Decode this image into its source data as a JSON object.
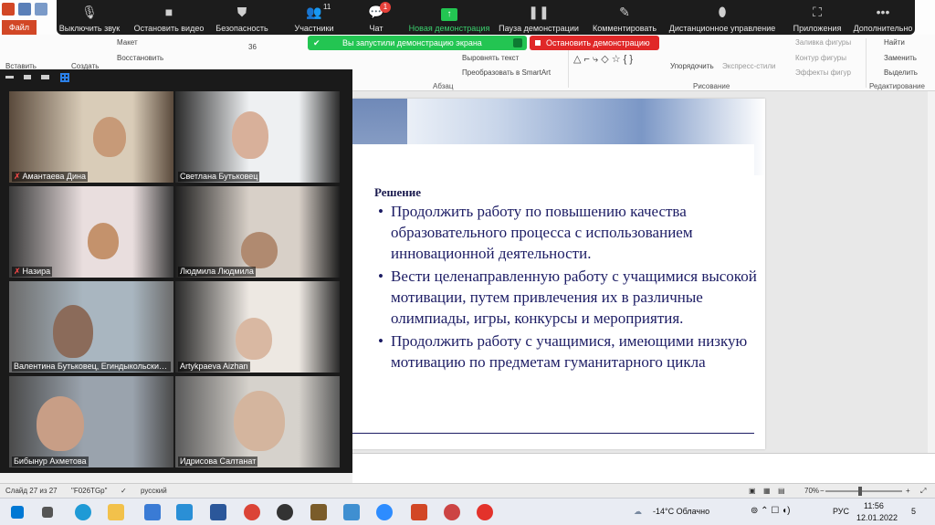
{
  "powerpoint": {
    "file_tab": "Файл",
    "ribbon": {
      "insert_label": "Вставить",
      "create_label": "Создать",
      "layout_label": "Макет",
      "restore_label": "Восстановить",
      "font_size": "36",
      "align_text": "Выровнять текст",
      "smartart": "Преобразовать в SmartArt",
      "paragraph_group": "Абзац",
      "arrange_label": "Упорядочить",
      "quick_styles": "Экспресс-стили",
      "drawing_group": "Рисование",
      "shape_fill": "Заливка фигуры",
      "shape_outline": "Контур фигуры",
      "shape_effects": "Эффекты фигур",
      "find": "Найти",
      "replace": "Заменить",
      "select": "Выделить",
      "editing_group": "Редактирование"
    },
    "statusbar": {
      "slide_counter": "Слайд 27 из 27",
      "theme": "\"F026TGp\"",
      "language": "русский",
      "zoom": "70%"
    }
  },
  "zoom": {
    "toolbar": [
      {
        "key": "mute",
        "label": "Выключить звук",
        "icon": "microphone-icon",
        "glyph": "🎙"
      },
      {
        "key": "video",
        "label": "Остановить видео",
        "icon": "camera-icon",
        "glyph": "■"
      },
      {
        "key": "security",
        "label": "Безопасность",
        "icon": "shield-icon",
        "glyph": "⛊"
      },
      {
        "key": "participants",
        "label": "Участники",
        "icon": "people-icon",
        "glyph": "👥"
      },
      {
        "key": "chat",
        "label": "Чат",
        "icon": "chat-bubble-icon",
        "glyph": "💬"
      },
      {
        "key": "new-share",
        "label": "Новая демонстрация",
        "icon": "share-arrow-icon",
        "glyph": "↑"
      },
      {
        "key": "pause-share",
        "label": "Пауза демонстрации",
        "icon": "pause-icon",
        "glyph": "❚❚"
      },
      {
        "key": "annotate",
        "label": "Комментировать",
        "icon": "pen-icon",
        "glyph": "✎"
      },
      {
        "key": "remote",
        "label": "Дистанционное управление",
        "icon": "mouse-icon",
        "glyph": "⬮"
      },
      {
        "key": "apps",
        "label": "Приложения",
        "icon": "apps-icon",
        "glyph": "⛶"
      },
      {
        "key": "more",
        "label": "Дополнительно",
        "icon": "more-dots-icon",
        "glyph": "•••"
      }
    ],
    "participants_count": "11",
    "chat_badge": "1",
    "share_banner": "Вы запустили демонстрацию экрана",
    "stop_share": "Остановить демонстрацию",
    "gallery": [
      {
        "name": "Амантаева Дина",
        "muted": true
      },
      {
        "name": "Светлана Бутьковец",
        "muted": false
      },
      {
        "name": "Назира",
        "muted": true
      },
      {
        "name": "Людмила Людмила",
        "muted": false
      },
      {
        "name": "Валентина Бутьковец, Егиндыкольский...",
        "muted": false
      },
      {
        "name": "Artykpaeva Aizhan",
        "muted": false
      },
      {
        "name": "Бибынур Ахметова",
        "muted": false
      },
      {
        "name": "Идрисова Салтанат",
        "muted": false
      }
    ]
  },
  "slide": {
    "title": "Решение",
    "bullets": [
      "Продолжить работу по повышению качества образовательного процесса с использованием инновационной деятельности.",
      "Вести целенаправленную работу с учащимися высокой мотивации, путем привлечения их в различные олимпиады, игры, конкурсы и мероприятия.",
      "Продолжить работу с учащимися, имеющими низкую мотивацию по предметам гуманитарного цикла"
    ]
  },
  "taskbar": {
    "weather": "-14°C Облачно",
    "lang": "РУС",
    "time": "11:56",
    "date": "12.01.2022",
    "notifications": "5"
  },
  "colors": {
    "zoom_green": "#23c552",
    "stop_red": "#e02828",
    "slide_text": "#1c1c64",
    "ppt_orange": "#d24726"
  }
}
